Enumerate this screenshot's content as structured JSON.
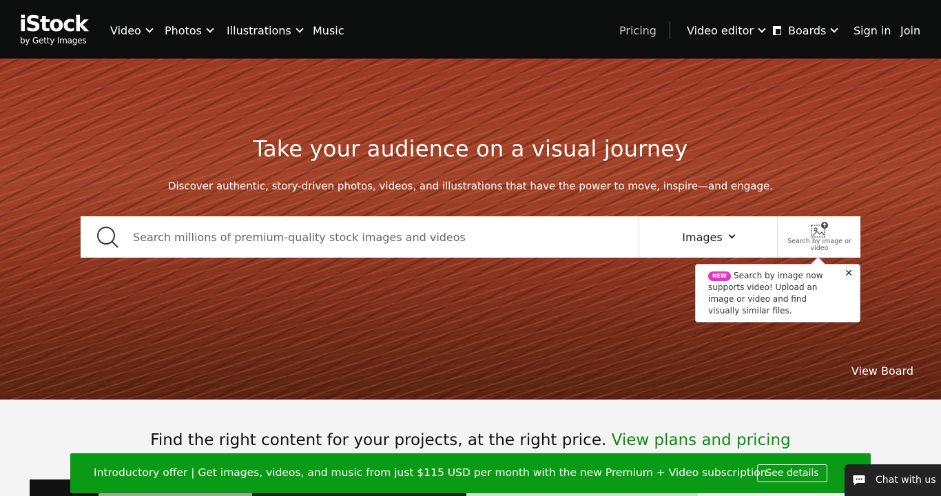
{
  "header": {
    "logo_main": "iStock",
    "logo_sub": "by Getty Images",
    "nav": [
      {
        "label": "Video",
        "has_dropdown": true
      },
      {
        "label": "Photos",
        "has_dropdown": true
      },
      {
        "label": "Illustrations",
        "has_dropdown": true
      },
      {
        "label": "Music",
        "has_dropdown": false
      }
    ],
    "pricing": "Pricing",
    "video_editor": "Video editor",
    "boards": "Boards",
    "sign_in": "Sign in",
    "join": "Join"
  },
  "hero": {
    "title": "Take your audience on a visual journey",
    "subtitle": "Discover authentic, story-driven photos, videos, and illustrations that have the power to move, inspire—and engage.",
    "search_placeholder": "Search millions of premium-quality stock images and videos",
    "search_type": "Images",
    "visual_search_label": "Search by image or video",
    "tooltip": {
      "badge": "NEW",
      "text": "Search by image now supports video! Upload an image or video and find visually similar files.",
      "close": "✕"
    },
    "view_board": "View Board"
  },
  "content": {
    "find_text": "Find the right content for your projects, at the right price.",
    "find_link": "View plans and pricing"
  },
  "promo": {
    "text": "Introductory offer | Get images, videos, and music from just $115 USD per month with the new Premium + Video subscription.",
    "button": "See details"
  },
  "chat": {
    "label": "Chat with us"
  },
  "colors": {
    "header_bg": "#0c0d0d",
    "accent_green": "#0b9a15",
    "link_green": "#0c8d12",
    "new_badge": "#e634c7"
  }
}
